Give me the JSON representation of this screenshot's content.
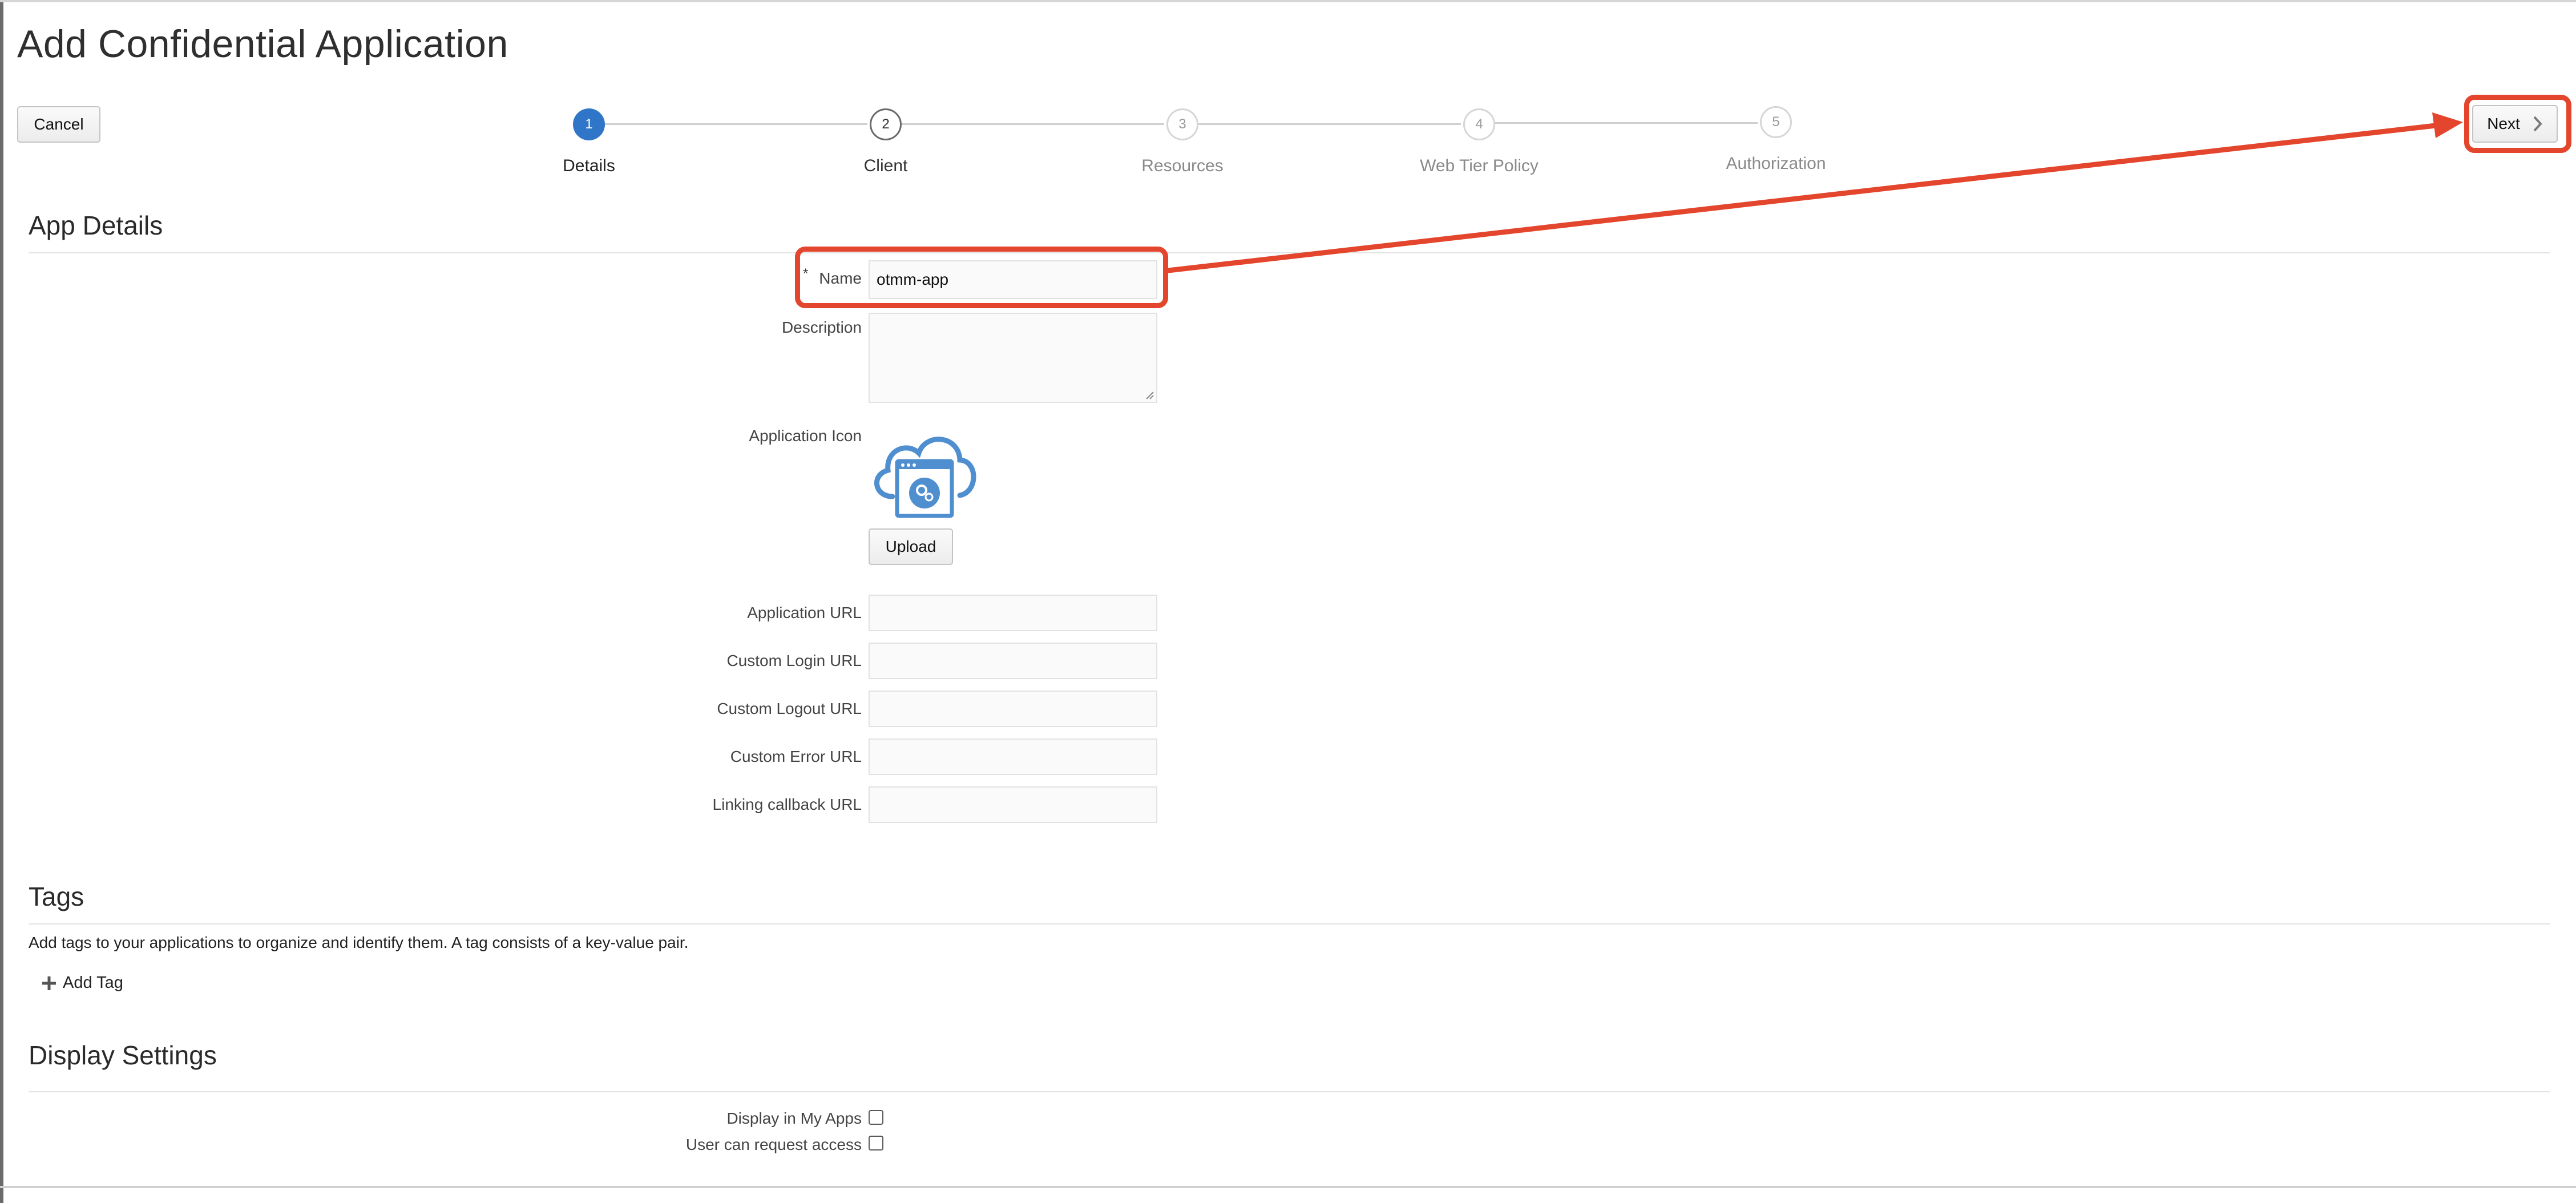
{
  "page": {
    "title": "Add Confidential Application"
  },
  "toolbar": {
    "cancel_label": "Cancel",
    "next_label": "Next",
    "next_icon": "chevron-right-icon"
  },
  "train": {
    "steps": [
      {
        "number": "1",
        "label": "Details",
        "state": "active"
      },
      {
        "number": "2",
        "label": "Client",
        "state": "next"
      },
      {
        "number": "3",
        "label": "Resources",
        "state": "disabled"
      },
      {
        "number": "4",
        "label": "Web Tier Policy",
        "state": "disabled"
      },
      {
        "number": "5",
        "label": "Authorization",
        "state": "disabled"
      }
    ]
  },
  "app_details": {
    "header": "App Details",
    "required_marker": "*",
    "name_label": "Name",
    "name_value": "otmm-app",
    "description_label": "Description",
    "description_value": "",
    "icon_label": "Application Icon",
    "icon": "cloud-app-icon",
    "upload_label": "Upload",
    "url_fields": [
      {
        "label": "Application URL",
        "value": ""
      },
      {
        "label": "Custom Login URL",
        "value": ""
      },
      {
        "label": "Custom Logout URL",
        "value": ""
      },
      {
        "label": "Custom Error URL",
        "value": ""
      },
      {
        "label": "Linking callback URL",
        "value": ""
      }
    ]
  },
  "tags": {
    "header": "Tags",
    "description": "Add tags to your applications to organize and identify them. A tag consists of a key-value pair.",
    "add_tag_label": "Add Tag",
    "add_icon": "plus-icon"
  },
  "display_settings": {
    "header": "Display Settings",
    "display_in_my_apps_label": "Display in My Apps",
    "display_in_my_apps_checked": false,
    "user_can_request_access_label": "User can request access",
    "user_can_request_access_checked": false
  },
  "colors": {
    "active_step": "#2f76c8",
    "annotation": "#e3452d",
    "icon_blue": "#4f8fd0"
  }
}
